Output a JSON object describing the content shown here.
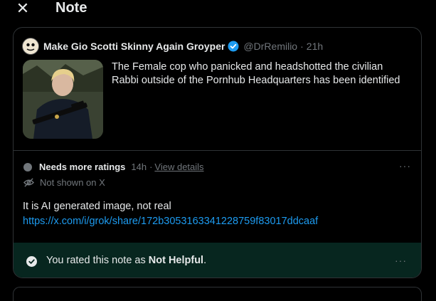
{
  "header": {
    "title": "Note",
    "close_icon": "close-icon"
  },
  "post": {
    "display_name": "Make Gio Scotti Skinny Again Groyper",
    "handle": "@DrRemilio",
    "separator": "·",
    "time": "21h",
    "text": "The Female cop who panicked and headshotted the civilian Rabbi outside of the Pornhub Headquarters has been identified"
  },
  "note": {
    "status": "Needs more ratings",
    "time": "14h",
    "separator": "·",
    "details_link": "View details",
    "not_shown": "Not shown on X",
    "text": "It is AI generated image, not real",
    "link": "https://x.com/i/grok/share/172b3053163341228759f83017ddcaaf",
    "rated_prefix": "You rated this note as ",
    "rated_value": "Not Helpful",
    "rated_suffix": ".",
    "more": "···"
  },
  "colors": {
    "background": "#000000",
    "accent_link": "#1d9bf0",
    "muted_text": "#71767b",
    "rated_bar": "#07261f",
    "verified": "#1d9bf0"
  }
}
